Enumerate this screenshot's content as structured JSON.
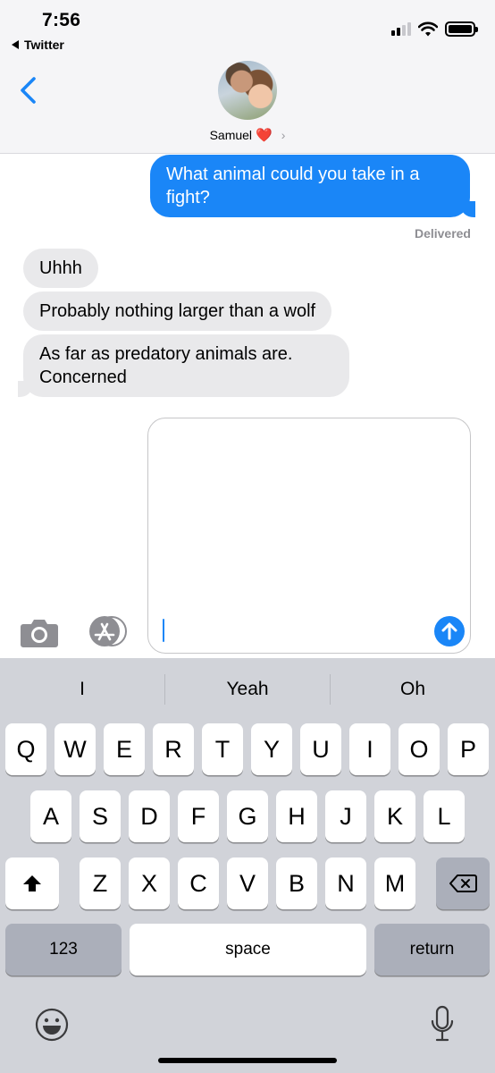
{
  "status_bar": {
    "time": "7:56",
    "back_app": "Twitter"
  },
  "header": {
    "contact_name": "Samuel",
    "contact_emoji": "❤️",
    "chevron": "›"
  },
  "messages": [
    {
      "direction": "sent",
      "text": "What animal could you take in a fight?"
    },
    {
      "direction": "received",
      "text": "Uhhh"
    },
    {
      "direction": "received",
      "text": "Probably nothing larger than a wolf"
    },
    {
      "direction": "received",
      "text": "As far as predatory animals are. Concerned"
    }
  ],
  "delivery_status": "Delivered",
  "composer": {
    "value": "",
    "icons": [
      "camera-icon",
      "app-store-icon",
      "send-arrow-icon"
    ]
  },
  "keyboard": {
    "suggestions": [
      "I",
      "Yeah",
      "Oh"
    ],
    "row1": [
      "Q",
      "W",
      "E",
      "R",
      "T",
      "Y",
      "U",
      "I",
      "O",
      "P"
    ],
    "row2": [
      "A",
      "S",
      "D",
      "F",
      "G",
      "H",
      "J",
      "K",
      "L"
    ],
    "row3": [
      "Z",
      "X",
      "C",
      "V",
      "B",
      "N",
      "M"
    ],
    "numbers_label": "123",
    "space_label": "space",
    "return_label": "return",
    "icons": [
      "shift-icon",
      "delete-icon",
      "emoji-icon",
      "microphone-icon"
    ]
  },
  "colors": {
    "sent_bubble": "#1a86f7",
    "received_bubble": "#e9e9eb",
    "keyboard_bg": "#d1d3d9"
  }
}
